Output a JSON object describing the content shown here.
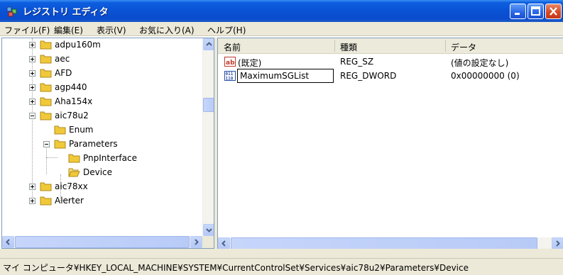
{
  "window": {
    "title": "レジストリ エディタ"
  },
  "menubar": [
    {
      "label": "ファイル(F)"
    },
    {
      "label": "編集(E)"
    },
    {
      "label": "表示(V)"
    },
    {
      "label": "お気に入り(A)"
    },
    {
      "label": "ヘルプ(H)"
    }
  ],
  "tree": {
    "items": [
      {
        "label": "adpu160m",
        "expander": "plus"
      },
      {
        "label": "aec",
        "expander": "plus"
      },
      {
        "label": "AFD",
        "expander": "plus"
      },
      {
        "label": "agp440",
        "expander": "plus"
      },
      {
        "label": "Aha154x",
        "expander": "plus"
      },
      {
        "label": "aic78u2",
        "expander": "minus"
      },
      {
        "label": "Enum",
        "expander": "none"
      },
      {
        "label": "Parameters",
        "expander": "minus"
      },
      {
        "label": "PnpInterface",
        "expander": "none"
      },
      {
        "label": "Device",
        "expander": "none",
        "selected_open": true
      },
      {
        "label": "aic78xx",
        "expander": "plus"
      },
      {
        "label": "Alerter",
        "expander": "plus"
      }
    ]
  },
  "list": {
    "columns": [
      "名前",
      "種類",
      "データ"
    ],
    "rows": [
      {
        "name": "(既定)",
        "type": "REG_SZ",
        "data": "(値の設定なし)",
        "icon": "string-value-icon"
      },
      {
        "name": "MaximumSGList",
        "type": "REG_DWORD",
        "data": "0x00000000 (0)",
        "icon": "binary-value-icon",
        "editing": true
      }
    ]
  },
  "statusbar": {
    "path": "マイ コンピュータ¥HKEY_LOCAL_MACHINE¥SYSTEM¥CurrentControlSet¥Services¥aic78u2¥Parameters¥Device"
  },
  "colors": {
    "titlebar": "#0a52d4",
    "close_button": "#d84a23",
    "chrome": "#ece9d8",
    "folder": "#f0c93a"
  }
}
